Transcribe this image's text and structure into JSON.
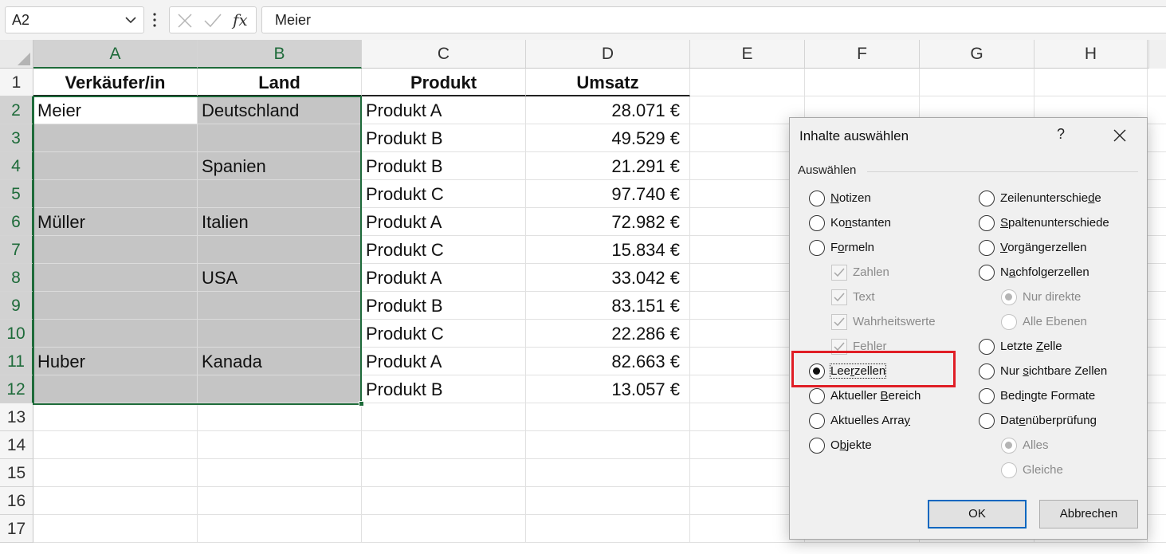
{
  "formula_bar": {
    "name_box": "A2",
    "fx_label": "fx",
    "formula": "Meier"
  },
  "grid": {
    "columns": [
      "A",
      "B",
      "C",
      "D",
      "E",
      "F",
      "G",
      "H"
    ],
    "rows": [
      "1",
      "2",
      "3",
      "4",
      "5",
      "6",
      "7",
      "8",
      "9",
      "10",
      "11",
      "12",
      "13",
      "14",
      "15",
      "16",
      "17"
    ],
    "headers": [
      "Verkäufer/in",
      "Land",
      "Produkt",
      "Umsatz"
    ],
    "data": [
      [
        "Meier",
        "Deutschland",
        "Produkt A",
        "28.071 €"
      ],
      [
        "",
        "",
        "Produkt B",
        "49.529 €"
      ],
      [
        "",
        "Spanien",
        "Produkt B",
        "21.291 €"
      ],
      [
        "",
        "",
        "Produkt C",
        "97.740 €"
      ],
      [
        "Müller",
        "Italien",
        "Produkt A",
        "72.982 €"
      ],
      [
        "",
        "",
        "Produkt C",
        "15.834 €"
      ],
      [
        "",
        "USA",
        "Produkt A",
        "33.042 €"
      ],
      [
        "",
        "",
        "Produkt B",
        "83.151 €"
      ],
      [
        "",
        "",
        "Produkt C",
        "22.286 €"
      ],
      [
        "Huber",
        "Kanada",
        "Produkt A",
        "82.663 €"
      ],
      [
        "",
        "",
        "Produkt B",
        "13.057 €"
      ]
    ]
  },
  "dialog": {
    "title": "Inhalte auswählen",
    "help": "?",
    "group_label": "Auswählen",
    "left_options": [
      {
        "pre": "",
        "u": "N",
        "post": "otizen",
        "kind": "radio",
        "checked": false,
        "disabled": false
      },
      {
        "pre": "Ko",
        "u": "n",
        "post": "stanten",
        "kind": "radio",
        "checked": false,
        "disabled": false
      },
      {
        "pre": "F",
        "u": "o",
        "post": "rmeln",
        "kind": "radio",
        "checked": false,
        "disabled": false
      },
      {
        "pre": "",
        "u": "",
        "post": "Zahlen",
        "kind": "check",
        "checked": true,
        "disabled": true
      },
      {
        "pre": "",
        "u": "",
        "post": "Text",
        "kind": "check",
        "checked": true,
        "disabled": true
      },
      {
        "pre": "",
        "u": "",
        "post": "Wahrheitswerte",
        "kind": "check",
        "checked": true,
        "disabled": true
      },
      {
        "pre": "",
        "u": "",
        "post": "Fehler",
        "kind": "check",
        "checked": true,
        "disabled": true
      },
      {
        "pre": "Lee",
        "u": "r",
        "post": "zellen",
        "kind": "radio",
        "checked": true,
        "disabled": false
      },
      {
        "pre": "Aktueller ",
        "u": "B",
        "post": "ereich",
        "kind": "radio",
        "checked": false,
        "disabled": false
      },
      {
        "pre": "Aktuelles Arra",
        "u": "y",
        "post": "",
        "kind": "radio",
        "checked": false,
        "disabled": false
      },
      {
        "pre": "O",
        "u": "b",
        "post": "jekte",
        "kind": "radio",
        "checked": false,
        "disabled": false
      }
    ],
    "right_options": [
      {
        "pre": "Zeilenunterschie",
        "u": "d",
        "post": "e",
        "kind": "radio",
        "checked": false,
        "disabled": false
      },
      {
        "pre": "",
        "u": "S",
        "post": "paltenunterschiede",
        "kind": "radio",
        "checked": false,
        "disabled": false
      },
      {
        "pre": "",
        "u": "V",
        "post": "orgängerzellen",
        "kind": "radio",
        "checked": false,
        "disabled": false
      },
      {
        "pre": "N",
        "u": "a",
        "post": "chfolgerzellen",
        "kind": "radio",
        "checked": false,
        "disabled": false
      },
      {
        "pre": "",
        "u": "",
        "post": "Nur direkte",
        "kind": "radio",
        "checked": true,
        "disabled": true
      },
      {
        "pre": "",
        "u": "",
        "post": "Alle Ebenen",
        "kind": "radio",
        "checked": false,
        "disabled": true
      },
      {
        "pre": "Letzte ",
        "u": "Z",
        "post": "elle",
        "kind": "radio",
        "checked": false,
        "disabled": false
      },
      {
        "pre": "Nur ",
        "u": "s",
        "post": "ichtbare Zellen",
        "kind": "radio",
        "checked": false,
        "disabled": false
      },
      {
        "pre": "Bed",
        "u": "i",
        "post": "ngte Formate",
        "kind": "radio",
        "checked": false,
        "disabled": false
      },
      {
        "pre": "Dat",
        "u": "e",
        "post": "nüberprüfung",
        "kind": "radio",
        "checked": false,
        "disabled": false
      },
      {
        "pre": "",
        "u": "",
        "post": "Alles",
        "kind": "radio",
        "checked": true,
        "disabled": true
      },
      {
        "pre": "",
        "u": "",
        "post": "Gleiche",
        "kind": "radio",
        "checked": false,
        "disabled": true
      }
    ],
    "ok_label": "OK",
    "cancel_label": "Abbrechen"
  },
  "colors": {
    "selection": "#1e6b3a",
    "highlight": "#e01e26",
    "default_button": "#0067c0"
  }
}
